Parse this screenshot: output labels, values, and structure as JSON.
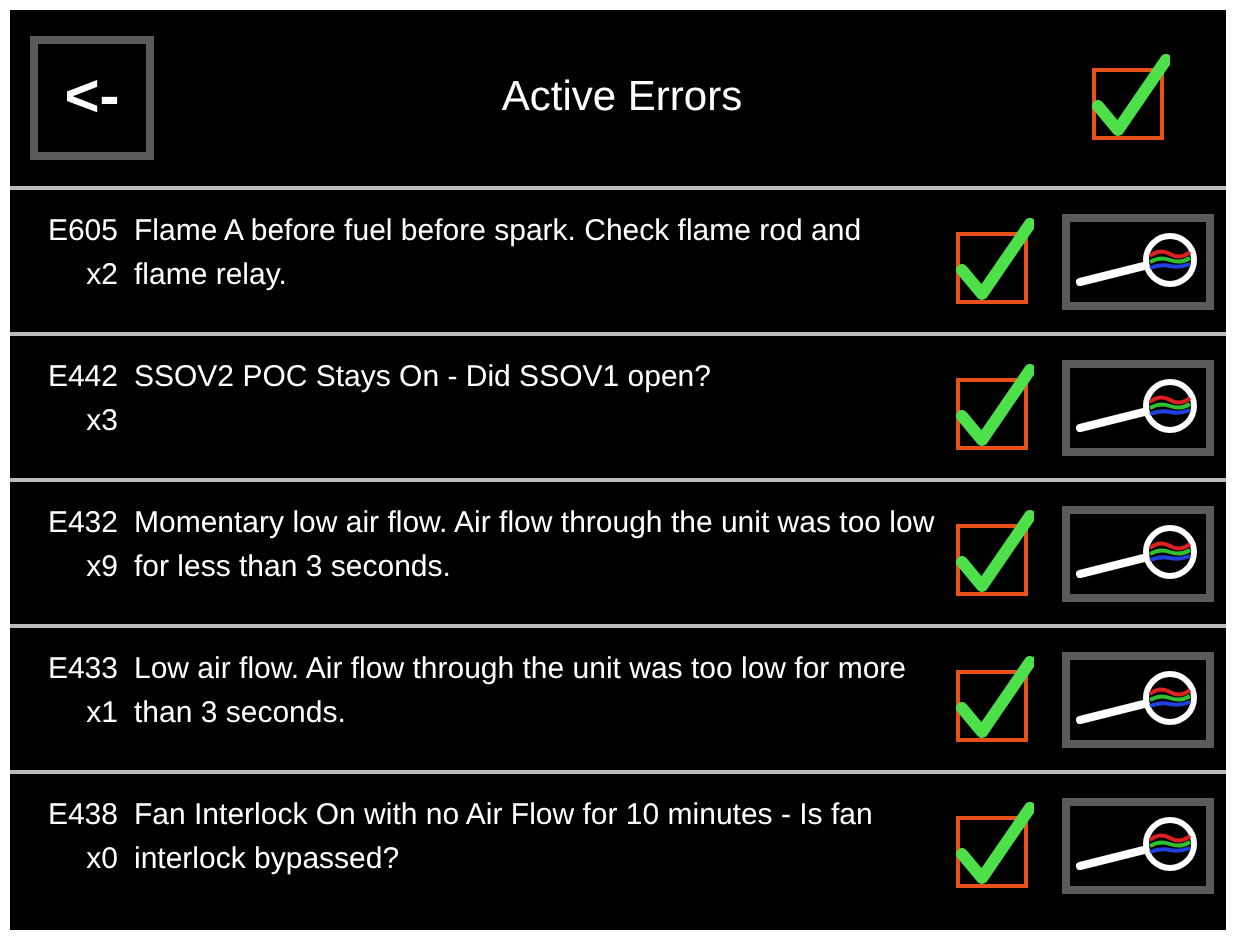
{
  "header": {
    "back_button": "<-",
    "title": "Active Errors",
    "acknowledge_all": {
      "checked": true
    }
  },
  "errors": [
    {
      "code": "E605",
      "count": "x2",
      "message": "Flame A before fuel before spark. Check flame rod and flame relay.",
      "checked": true
    },
    {
      "code": "E442",
      "count": "x3",
      "message": "SSOV2 POC Stays On - Did SSOV1 open?",
      "checked": true
    },
    {
      "code": "E432",
      "count": "x9",
      "message": "Momentary low air flow. Air flow through the unit was too low for less than 3 seconds.",
      "checked": true
    },
    {
      "code": "E433",
      "count": "x1",
      "message": "Low air flow. Air flow through the unit was too low for more than 3 seconds.",
      "checked": true
    },
    {
      "code": "E438",
      "count": "x0",
      "message": "Fan Interlock On with no Air Flow for 10 minutes - Is fan interlock bypassed?",
      "checked": true
    }
  ]
}
